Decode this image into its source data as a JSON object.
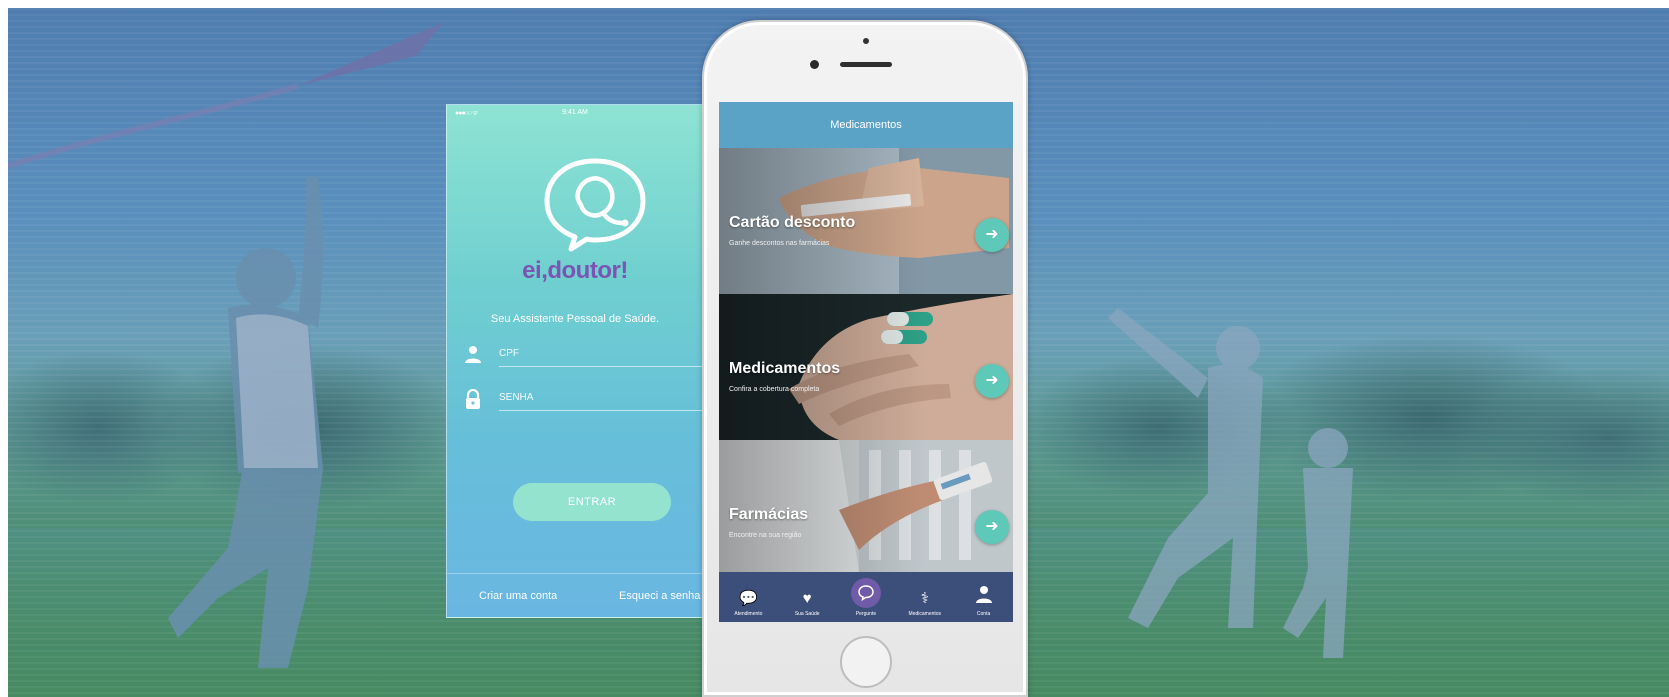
{
  "login": {
    "status_time": "9:41 AM",
    "brand": "ei,doutor!",
    "tagline": "Seu Assistente Pessoal de Saúde.",
    "cpf_placeholder": "CPF",
    "senha_placeholder": "SENHA",
    "enter_button": "ENTRAR",
    "create_account": "Criar uma conta",
    "forgot_password": "Esqueci a senha"
  },
  "app": {
    "title": "Medicamentos",
    "cards": [
      {
        "title": "Cartão desconto",
        "subtitle": "Ganhe descontos nas farmácias"
      },
      {
        "title": "Medicamentos",
        "subtitle": "Confira a cobertura completa"
      },
      {
        "title": "Farmácias",
        "subtitle": "Encontre na sua região"
      }
    ],
    "tabs": [
      {
        "label": "Atendimento",
        "icon": "chat-bubbles-icon"
      },
      {
        "label": "Sua Saúde",
        "icon": "heart-icon"
      },
      {
        "label": "Pergunte",
        "icon": "ask-icon"
      },
      {
        "label": "Medicamentos",
        "icon": "pharmacist-icon"
      },
      {
        "label": "Conta",
        "icon": "user-icon"
      }
    ]
  },
  "colors": {
    "brand_purple": "#7a55b3",
    "accent_teal": "#5ec9b8",
    "nav_blue": "#5aa2c6",
    "tab_bar": "#3c4e7a"
  }
}
